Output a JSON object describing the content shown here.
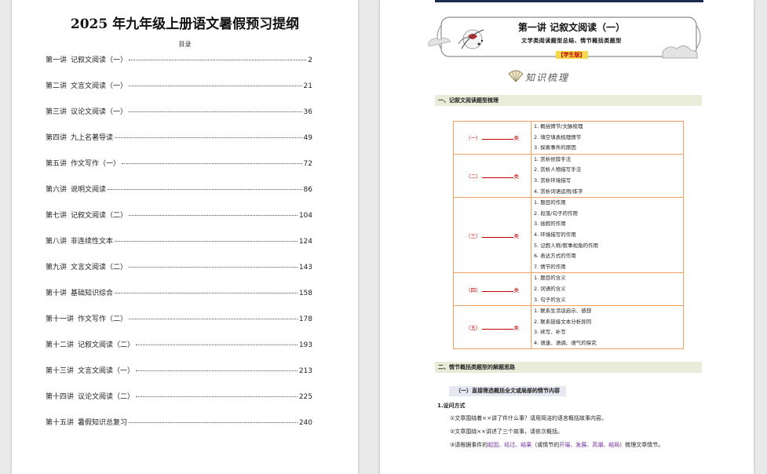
{
  "left_page": {
    "title": "2025 年九年级上册语文暑假预习提纲",
    "toc_heading": "目录",
    "toc": [
      {
        "lecture": "第一讲",
        "topic": "记叙文阅读（一）",
        "page": "2"
      },
      {
        "lecture": "第二讲",
        "topic": "文言文阅读（一）",
        "page": "21"
      },
      {
        "lecture": "第三讲",
        "topic": "议论文阅读（一）",
        "page": "36"
      },
      {
        "lecture": "第四讲",
        "topic": "九上名著导读",
        "page": "49"
      },
      {
        "lecture": "第五讲",
        "topic": "作文写作（一）",
        "page": "72"
      },
      {
        "lecture": "第六讲",
        "topic": "说明文阅读",
        "page": "86"
      },
      {
        "lecture": "第七讲",
        "topic": "记叙文阅读（二）",
        "page": "104"
      },
      {
        "lecture": "第八讲",
        "topic": "非连续性文本",
        "page": "124"
      },
      {
        "lecture": "第九讲",
        "topic": "文言文阅读（二）",
        "page": "143"
      },
      {
        "lecture": "第十讲",
        "topic": "基础知识综合",
        "page": "158"
      },
      {
        "lecture": "第十一讲",
        "topic": "作文写作（二）",
        "page": "178"
      },
      {
        "lecture": "第十二讲",
        "topic": "记叙文阅读（二）",
        "page": "193"
      },
      {
        "lecture": "第十三讲",
        "topic": "文言文阅读（一）",
        "page": "213"
      },
      {
        "lecture": "第十四讲",
        "topic": "议论文阅读（二）",
        "page": "225"
      },
      {
        "lecture": "第十五讲",
        "topic": "暑假知识总复习",
        "page": "240"
      }
    ]
  },
  "right_page": {
    "lecture_title": "第一讲  记叙文阅读（一）",
    "lecture_subtitle": "文学类阅读题型总结、情节概括类题型",
    "student_tag": "【学生版】",
    "knowledge_banner": "知识梳理",
    "section1": "一、记叙文阅读题型梳理",
    "categories": [
      {
        "prefix": "（一）",
        "suffix": "类",
        "items": [
          "1. 概括情节/文脉梳理",
          "2. 填空填表梳理情节",
          "3. 探索事件的原因"
        ]
      },
      {
        "prefix": "（二）",
        "suffix": "类",
        "items": [
          "1. 赏析修辞手法",
          "2. 赏析人物描写手法",
          "3. 赏析环境描写",
          "4. 赏析词语运用/炼字"
        ]
      },
      {
        "prefix": "（三）",
        "suffix": "类",
        "items": [
          "1. 题目的作用",
          "2. 段落/句子的作用",
          "3. 插叙的作用",
          "4. 环境描写的作用",
          "5. 记叙人称/叙事视角的作用",
          "6. 表达方式的作用",
          "7. 情节的作用"
        ]
      },
      {
        "prefix": "（四）",
        "suffix": "类",
        "items": [
          "1. 题目的含义",
          "2. 词语的含义",
          "3. 句子的含义"
        ]
      },
      {
        "prefix": "（五）",
        "suffix": "类",
        "items": [
          "1. 联系生活谈启示、感想",
          "2. 联系链接文本分析异同",
          "3. 续写、补写",
          "4. 语速、语调、语气的探究"
        ]
      }
    ],
    "section2": "二、情节概括类题型的解题思路",
    "sub_heading": "（一）直接筛选概括全文或局部的情节内容",
    "method_label": "1.设问方式",
    "questions": {
      "q1": "①文章围绕着××讲了件什么事？请用简洁的语言概括故事内容。",
      "q2": "②文章围绕××讲述了三个故事，请依次概括。",
      "q3_a": "③请根据事件的",
      "q3_h1": "起因、经过、结果",
      "q3_b": "（或情节的",
      "q3_h2": "开端、发展、高潮、结局",
      "q3_c": "）梳理文章情节。"
    },
    "colors": {
      "accent_red": "#c00000",
      "highlight_purple": "#7030a0",
      "table_border": "#f0a060",
      "tag_yellow": "#f6d94a"
    }
  }
}
